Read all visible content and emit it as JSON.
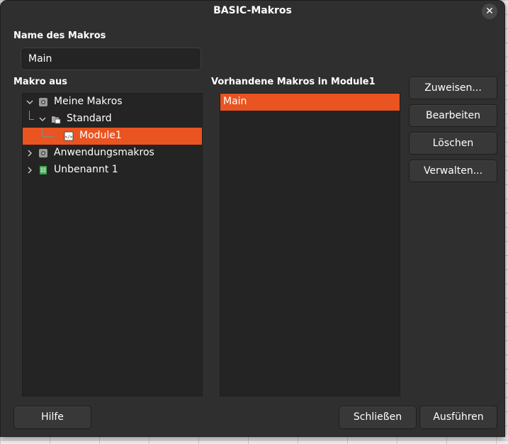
{
  "dialog": {
    "title": "BASIC-Makros",
    "close_icon": "close-icon"
  },
  "macro_name": {
    "label": "Name des Makros",
    "value": "Main"
  },
  "macro_from": {
    "label": "Makro aus",
    "tree": [
      {
        "label": "Meine Makros",
        "icon": "library-icon",
        "expanded": true,
        "level": 0
      },
      {
        "label": "Standard",
        "icon": "folder-icon",
        "expanded": true,
        "level": 1
      },
      {
        "label": "Module1",
        "icon": "module-icon",
        "selected": true,
        "level": 2
      },
      {
        "label": "Anwendungsmakros",
        "icon": "library-icon",
        "expanded": false,
        "level": 0
      },
      {
        "label": "Unbenannt 1",
        "icon": "spreadsheet-icon",
        "expanded": false,
        "level": 0
      }
    ]
  },
  "existing_macros": {
    "label": "Vorhandene Makros in Module1",
    "items": [
      {
        "label": "Main",
        "selected": true
      }
    ]
  },
  "buttons": {
    "assign": "Zuweisen...",
    "edit": "Bearbeiten",
    "delete": "Löschen",
    "manage": "Verwalten...",
    "help": "Hilfe",
    "close": "Schließen",
    "run": "Ausführen"
  },
  "colors": {
    "dialog_bg": "#2f2f2f",
    "panel_bg": "#242424",
    "accent": "#e95420",
    "button_bg": "#383838"
  }
}
